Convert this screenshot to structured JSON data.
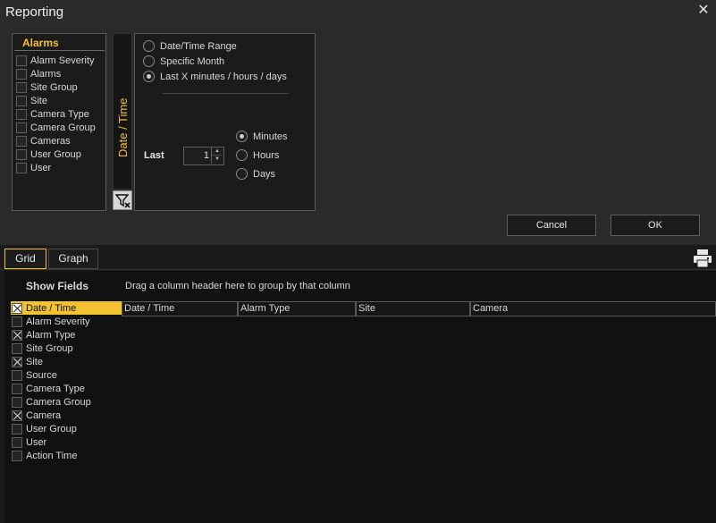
{
  "window": {
    "title": "Reporting",
    "close_glyph": "✕"
  },
  "alarms": {
    "heading": "Alarms",
    "items": [
      {
        "label": "Alarm Severity",
        "checked": false
      },
      {
        "label": "Alarms",
        "checked": false
      },
      {
        "label": "Site Group",
        "checked": false
      },
      {
        "label": "Site",
        "checked": false
      },
      {
        "label": "Camera Type",
        "checked": false
      },
      {
        "label": "Camera Group",
        "checked": false
      },
      {
        "label": "Cameras",
        "checked": false
      },
      {
        "label": "User Group",
        "checked": false
      },
      {
        "label": "User",
        "checked": false
      }
    ]
  },
  "date_time": {
    "tab_label": "Date / Time",
    "modes": [
      {
        "label": "Date/Time Range",
        "selected": false
      },
      {
        "label": "Specific Month",
        "selected": false
      },
      {
        "label": "Last  X  minutes / hours / days",
        "selected": true
      }
    ],
    "last_label": "Last",
    "last_value": "1",
    "units": [
      {
        "label": "Minutes",
        "selected": true
      },
      {
        "label": "Hours",
        "selected": false
      },
      {
        "label": "Days",
        "selected": false
      }
    ]
  },
  "buttons": {
    "cancel": "Cancel",
    "ok": "OK"
  },
  "tabs": [
    {
      "label": "Grid",
      "active": true
    },
    {
      "label": "Graph",
      "active": false
    }
  ],
  "grid": {
    "show_fields_label": "Show Fields",
    "group_hint": "Drag a column header here to group by that column",
    "fields": [
      {
        "label": "Date / Time",
        "checked": true,
        "selected": true
      },
      {
        "label": "Alarm Severity",
        "checked": false,
        "selected": false
      },
      {
        "label": "Alarm Type",
        "checked": true,
        "selected": false
      },
      {
        "label": "Site Group",
        "checked": false,
        "selected": false
      },
      {
        "label": "Site",
        "checked": true,
        "selected": false
      },
      {
        "label": "Source",
        "checked": false,
        "selected": false
      },
      {
        "label": "Camera Type",
        "checked": false,
        "selected": false
      },
      {
        "label": "Camera Group",
        "checked": false,
        "selected": false
      },
      {
        "label": "Camera",
        "checked": true,
        "selected": false
      },
      {
        "label": "User Group",
        "checked": false,
        "selected": false
      },
      {
        "label": "User",
        "checked": false,
        "selected": false
      },
      {
        "label": "Action Time",
        "checked": false,
        "selected": false
      }
    ],
    "columns": [
      "Date / Time",
      "Alarm Type",
      "Site",
      "Camera"
    ]
  },
  "colors": {
    "accent": "#f2c230",
    "background": "#1a1a1a"
  }
}
